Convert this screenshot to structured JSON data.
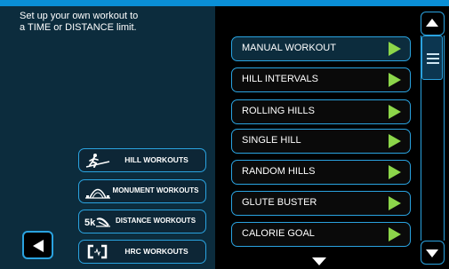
{
  "instructions": {
    "line1": "Set up your own workout to",
    "line2": "a TIME or DISTANCE limit."
  },
  "categories": [
    {
      "label": "HILL WORKOUTS",
      "icon": "hill-runner-icon"
    },
    {
      "label": "MONUMENT WORKOUTS",
      "icon": "monument-arch-icon"
    },
    {
      "label": "DISTANCE WORKOUTS",
      "icon": "5k-runner-icon",
      "icon_text": "5k"
    },
    {
      "label": "HRC WORKOUTS",
      "icon": "heart-rate-brackets-icon"
    }
  ],
  "workouts": [
    {
      "label": "MANUAL WORKOUT",
      "selected": true
    },
    {
      "label": "HILL INTERVALS"
    },
    {
      "label": "ROLLING HILLS"
    },
    {
      "label": "SINGLE HILL"
    },
    {
      "label": "RANDOM HILLS"
    },
    {
      "label": "GLUTE BUSTER"
    },
    {
      "label": "CALORIE GOAL"
    }
  ],
  "colors": {
    "accent": "#2aa3e0",
    "top_bar": "#0a8fd6",
    "panel": "#0c2c3d",
    "play": "#8cd64a"
  },
  "icons": {
    "back": "back-arrow-icon",
    "play": "play-icon",
    "scroll_up": "chevron-up-icon",
    "scroll_down": "chevron-down-icon",
    "thumb": "grip-lines-icon",
    "more": "more-below-arrow-icon"
  }
}
